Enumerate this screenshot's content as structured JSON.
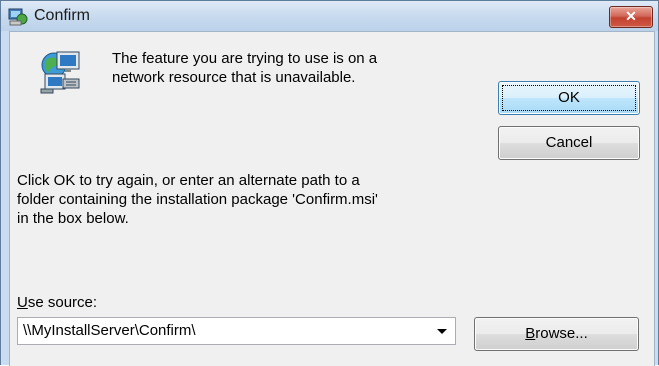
{
  "window": {
    "title": "Confirm"
  },
  "message": {
    "line1": "The feature you are trying to use is on a",
    "line2": "network resource that is unavailable."
  },
  "instructions": {
    "line1": "Click OK to try again, or enter an alternate path to a",
    "line2": "folder containing the installation package 'Confirm.msi'",
    "line3": "in the box below."
  },
  "buttons": {
    "ok": "OK",
    "cancel": "Cancel",
    "browse_mnemonic": "B",
    "browse_rest": "rowse..."
  },
  "source": {
    "label_mnemonic": "U",
    "label_rest": "se source:",
    "value": "\\\\MyInstallServer\\Confirm\\"
  },
  "icons": {
    "title": "installer-icon",
    "message": "network-computer-icon",
    "close": "close-icon",
    "dropdown": "chevron-down-icon"
  },
  "colors": {
    "close_button": "#c3412f",
    "ok_border": "#3c7fb1",
    "dialog_background": "#f0f0f0"
  }
}
